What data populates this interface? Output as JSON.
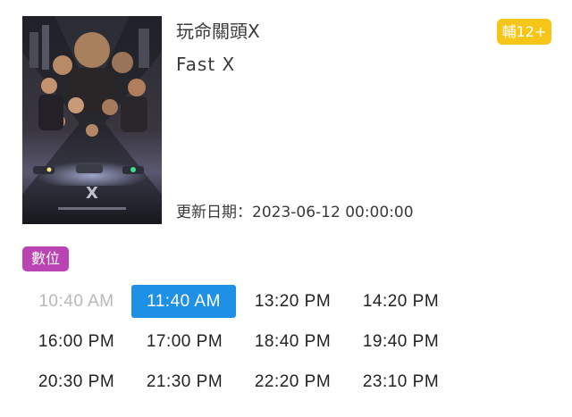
{
  "movie": {
    "title_zh": "玩命關頭X",
    "title_en": "Fast X",
    "rating": "輔12+",
    "update_label": "更新日期：",
    "update_value": "2023-06-12 00:00:00",
    "poster_icon": "movie-poster-image"
  },
  "format": {
    "label": "數位",
    "color": "#bb44b5"
  },
  "colors": {
    "rating_badge": "#f5c518",
    "selected_showtime": "#1e90e6",
    "past_showtime_text": "#b8b8b8"
  },
  "showtimes": [
    {
      "time": "10:40 AM",
      "state": "past"
    },
    {
      "time": "11:40 AM",
      "state": "selected"
    },
    {
      "time": "13:20 PM",
      "state": "available"
    },
    {
      "time": "14:20 PM",
      "state": "available"
    },
    {
      "time": "16:00 PM",
      "state": "available"
    },
    {
      "time": "17:00 PM",
      "state": "available"
    },
    {
      "time": "18:40 PM",
      "state": "available"
    },
    {
      "time": "19:40 PM",
      "state": "available"
    },
    {
      "time": "20:30 PM",
      "state": "available"
    },
    {
      "time": "21:30 PM",
      "state": "available"
    },
    {
      "time": "22:20 PM",
      "state": "available"
    },
    {
      "time": "23:10 PM",
      "state": "available"
    }
  ]
}
